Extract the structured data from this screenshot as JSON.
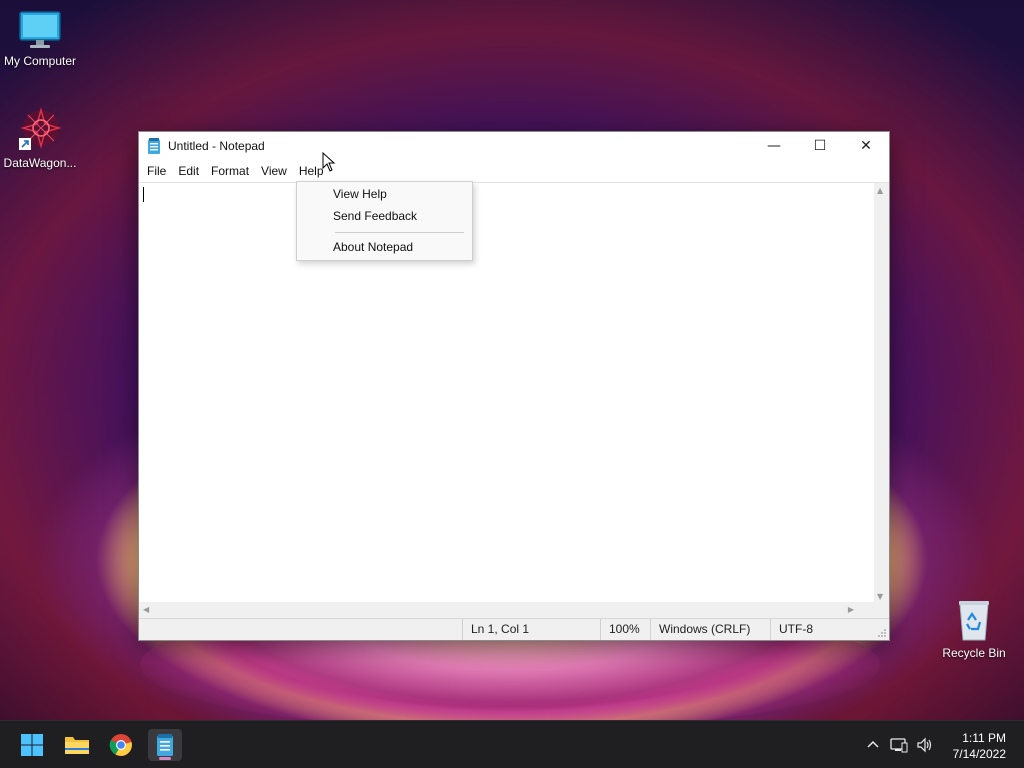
{
  "desktop": {
    "icons": [
      {
        "label": "My Computer",
        "icon": "monitor-icon"
      },
      {
        "label": "DataWagon...",
        "icon": "datawagon-shortcut-icon"
      },
      {
        "label": "Recycle Bin",
        "icon": "recycle-bin-icon"
      }
    ]
  },
  "notepad": {
    "title": "Untitled - Notepad",
    "menu": [
      "File",
      "Edit",
      "Format",
      "View",
      "Help"
    ],
    "window_buttons": {
      "minimize": "—",
      "maximize": "☐",
      "close": "✕"
    },
    "status": {
      "position": "Ln 1, Col 1",
      "zoom": "100%",
      "line_ending": "Windows (CRLF)",
      "encoding": "UTF-8"
    }
  },
  "help_menu": {
    "items": [
      "View Help",
      "Send Feedback",
      "About Notepad"
    ]
  },
  "taskbar": {
    "apps": [
      "start-icon",
      "file-explorer-icon",
      "chrome-icon",
      "notepad-icon"
    ],
    "clock": {
      "time": "1:11 PM",
      "date": "7/14/2022"
    }
  },
  "colors": {
    "accent": "#0078d4",
    "taskbar": "#1f1f22"
  }
}
